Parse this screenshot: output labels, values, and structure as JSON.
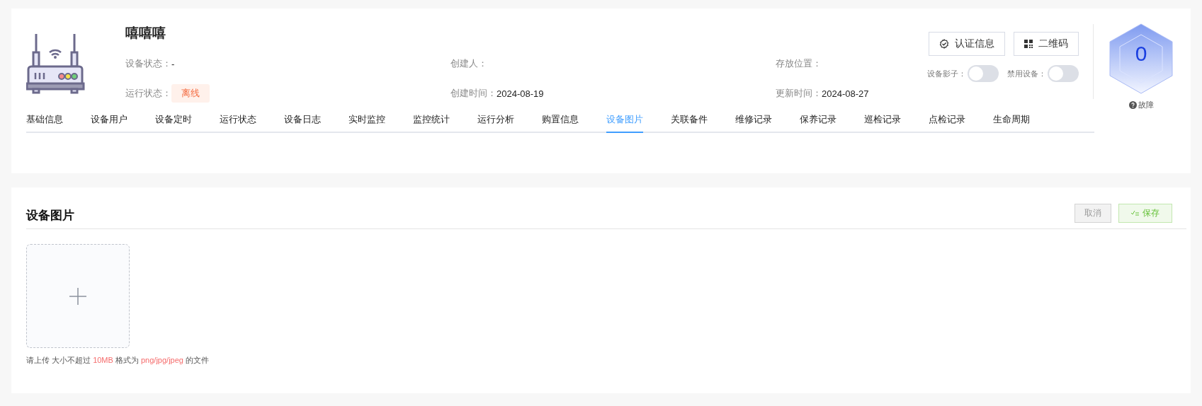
{
  "device": {
    "name": "嘻嘻嘻",
    "fields": [
      {
        "label": "设备状态：",
        "value": "-"
      },
      {
        "label": "创建人："
      },
      {
        "label": "存放位置："
      },
      {
        "label": "运行状态：",
        "badge": "离线"
      },
      {
        "label": "创建时间：",
        "value": "2024-08-19"
      },
      {
        "label": "更新时间：",
        "value": "2024-08-27"
      }
    ],
    "actions": [
      {
        "kind": "cert",
        "label": "认证信息"
      },
      {
        "kind": "qr",
        "label": "二维码"
      }
    ],
    "toggles": [
      {
        "label": "设备影子：",
        "on": false
      },
      {
        "label": "禁用设备：",
        "on": false
      }
    ],
    "fault": {
      "count": "0",
      "label": "故障"
    }
  },
  "tabs": [
    {
      "label": "基础信息",
      "selected": false
    },
    {
      "label": "设备用户",
      "selected": false
    },
    {
      "label": "设备定时",
      "selected": false
    },
    {
      "label": "运行状态",
      "selected": false
    },
    {
      "label": "设备日志",
      "selected": false
    },
    {
      "label": "实时监控",
      "selected": false
    },
    {
      "label": "监控统计",
      "selected": false
    },
    {
      "label": "运行分析",
      "selected": false
    },
    {
      "label": "购置信息",
      "selected": false
    },
    {
      "label": "设备图片",
      "selected": true
    },
    {
      "label": "关联备件",
      "selected": false
    },
    {
      "label": "维修记录",
      "selected": false
    },
    {
      "label": "保养记录",
      "selected": false
    },
    {
      "label": "巡检记录",
      "selected": false
    },
    {
      "label": "点检记录",
      "selected": false
    },
    {
      "label": "生命周期",
      "selected": false
    }
  ],
  "section": {
    "title": "设备图片",
    "buttons": [
      {
        "kind": "cancel",
        "label": "取消",
        "disabled": true
      },
      {
        "kind": "save",
        "label": "保存",
        "disabled": true
      }
    ],
    "hint": [
      {
        "text": "请上传 大小不超过 ",
        "highlight": false
      },
      {
        "text": "10MB",
        "highlight": true
      },
      {
        "text": " 格式为 ",
        "highlight": false
      },
      {
        "text": "png/jpg/jpeg",
        "highlight": true
      },
      {
        "text": " 的文件",
        "highlight": false
      }
    ]
  }
}
